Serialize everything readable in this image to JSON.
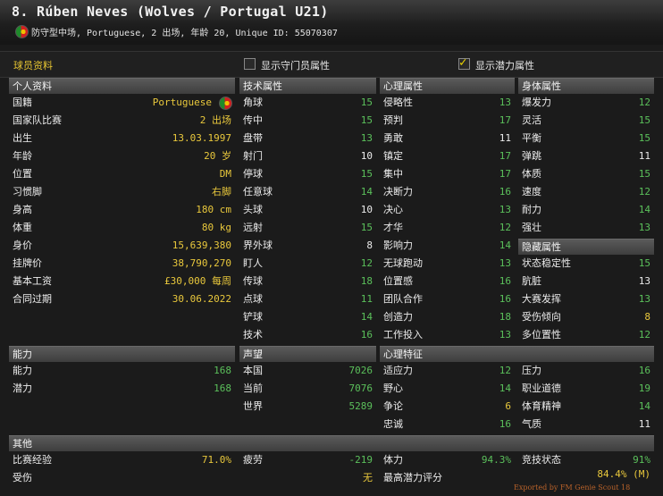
{
  "header": {
    "title": "8. Rúben Neves (Wolves / Portugal U21)",
    "subtitle": "防守型中场, Portuguese, 2 出场, 年龄 20, Unique ID: 55070307"
  },
  "topbar": {
    "tab_label": "球员资料",
    "gk_checkbox_label": "显示守门员属性",
    "potential_checkbox_label": "显示潜力属性",
    "potential_checked": true
  },
  "personal": {
    "title": "个人资料",
    "rows": [
      {
        "k": "国籍",
        "v": "Portuguese"
      },
      {
        "k": "国家队比赛",
        "v": "2 出场"
      },
      {
        "k": "出生",
        "v": "13.03.1997"
      },
      {
        "k": "年龄",
        "v": "20 岁"
      },
      {
        "k": "位置",
        "v": "DM"
      },
      {
        "k": "习惯脚",
        "v": "右脚"
      },
      {
        "k": "身高",
        "v": "180 cm"
      },
      {
        "k": "体重",
        "v": "80 kg"
      },
      {
        "k": "身价",
        "v": "15,639,380"
      },
      {
        "k": "挂牌价",
        "v": "38,790,270"
      },
      {
        "k": "基本工资",
        "v": "£30,000 每周"
      },
      {
        "k": "合同过期",
        "v": "30.06.2022"
      }
    ]
  },
  "technical": {
    "title": "技术属性",
    "rows": [
      {
        "k": "角球",
        "v": "15"
      },
      {
        "k": "传中",
        "v": "15"
      },
      {
        "k": "盘带",
        "v": "13"
      },
      {
        "k": "射门",
        "v": "10"
      },
      {
        "k": "停球",
        "v": "15"
      },
      {
        "k": "任意球",
        "v": "14"
      },
      {
        "k": "头球",
        "v": "10"
      },
      {
        "k": "远射",
        "v": "15"
      },
      {
        "k": "界外球",
        "v": "8"
      },
      {
        "k": "盯人",
        "v": "12"
      },
      {
        "k": "传球",
        "v": "18"
      },
      {
        "k": "点球",
        "v": "11"
      },
      {
        "k": "铲球",
        "v": "14"
      },
      {
        "k": "技术",
        "v": "16"
      }
    ]
  },
  "mental": {
    "title": "心理属性",
    "rows": [
      {
        "k": "侵略性",
        "v": "13"
      },
      {
        "k": "预判",
        "v": "17"
      },
      {
        "k": "勇敢",
        "v": "11"
      },
      {
        "k": "镇定",
        "v": "17"
      },
      {
        "k": "集中",
        "v": "17"
      },
      {
        "k": "决断力",
        "v": "16"
      },
      {
        "k": "决心",
        "v": "13"
      },
      {
        "k": "才华",
        "v": "12"
      },
      {
        "k": "影响力",
        "v": "14"
      },
      {
        "k": "无球跑动",
        "v": "13"
      },
      {
        "k": "位置感",
        "v": "16"
      },
      {
        "k": "团队合作",
        "v": "16"
      },
      {
        "k": "创造力",
        "v": "18"
      },
      {
        "k": "工作投入",
        "v": "13"
      }
    ]
  },
  "physical": {
    "title": "身体属性",
    "rows": [
      {
        "k": "爆发力",
        "v": "12"
      },
      {
        "k": "灵活",
        "v": "15"
      },
      {
        "k": "平衡",
        "v": "15"
      },
      {
        "k": "弹跳",
        "v": "11"
      },
      {
        "k": "体质",
        "v": "15"
      },
      {
        "k": "速度",
        "v": "12"
      },
      {
        "k": "耐力",
        "v": "14"
      },
      {
        "k": "强壮",
        "v": "13"
      }
    ]
  },
  "hidden": {
    "title": "隐藏属性",
    "rows": [
      {
        "k": "状态稳定性",
        "v": "15"
      },
      {
        "k": "肮脏",
        "v": "13"
      },
      {
        "k": "大赛发挥",
        "v": "13"
      },
      {
        "k": "受伤倾向",
        "v": "8"
      },
      {
        "k": "多位置性",
        "v": "12"
      }
    ]
  },
  "ability": {
    "title": "能力",
    "rows": [
      {
        "k": "能力",
        "v": "168"
      },
      {
        "k": "潜力",
        "v": "168"
      }
    ]
  },
  "reputation": {
    "title": "声望",
    "rows": [
      {
        "k": "本国",
        "v": "7026"
      },
      {
        "k": "当前",
        "v": "7076"
      },
      {
        "k": "世界",
        "v": "5289"
      }
    ]
  },
  "traits": {
    "title": "心理特征",
    "left": [
      {
        "k": "适应力",
        "v": "12"
      },
      {
        "k": "野心",
        "v": "14"
      },
      {
        "k": "争论",
        "v": "6"
      },
      {
        "k": "忠诚",
        "v": "16"
      }
    ],
    "right": [
      {
        "k": "压力",
        "v": "16"
      },
      {
        "k": "职业道德",
        "v": "19"
      },
      {
        "k": "体育精神",
        "v": "14"
      },
      {
        "k": "气质",
        "v": "11"
      }
    ]
  },
  "other": {
    "title": "其他",
    "match_exp_k": "比赛经验",
    "match_exp_v": "71.0%",
    "fatigue_k": "疲劳",
    "fatigue_v": "-219",
    "condition_k": "体力",
    "condition_v": "94.3%",
    "match_fit_k": "竞技状态",
    "match_fit_v": "91%",
    "injury_k": "受伤",
    "injury_v": "无",
    "best_pot_k": "最高潜力评分",
    "best_pot_v": "84.4% (M)"
  },
  "footer": "Exported by FM Genie Scout 18",
  "colors": {
    "yellow": "#e9c83c",
    "green": "#5bc05b",
    "accent": "#e6c431"
  }
}
